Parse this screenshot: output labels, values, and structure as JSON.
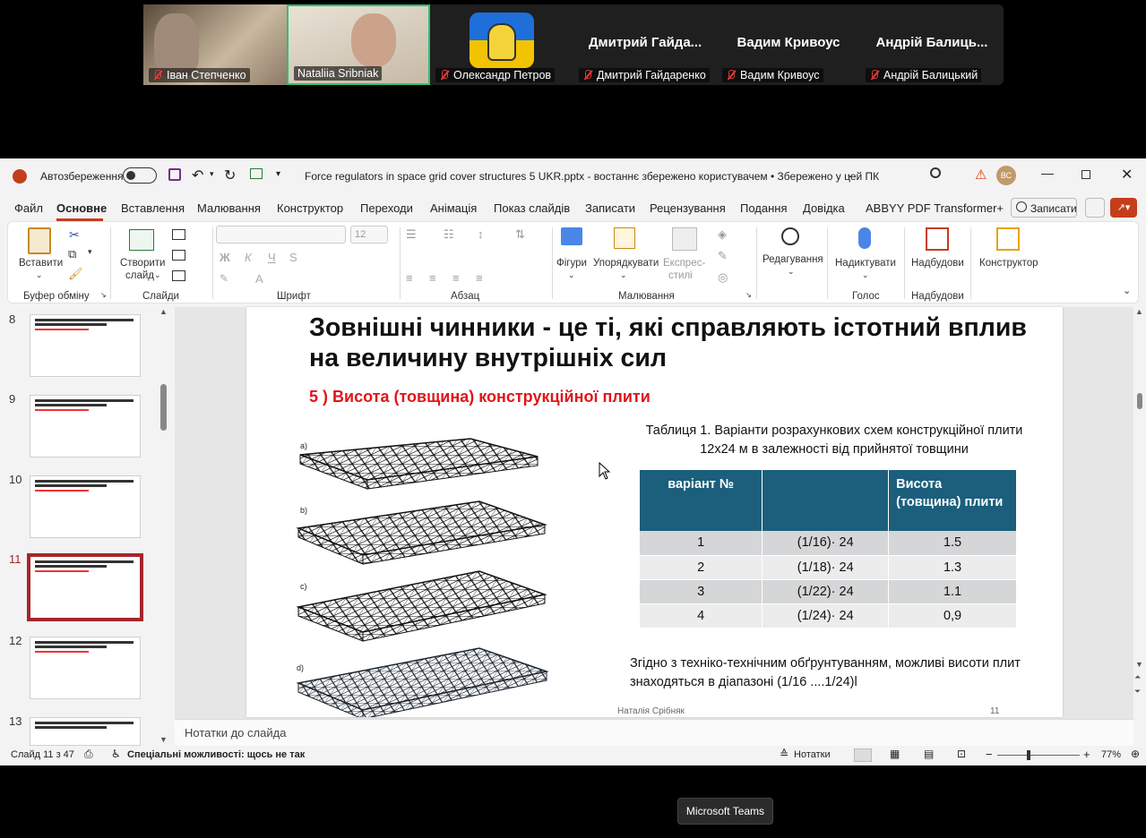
{
  "meeting": {
    "participants": [
      {
        "name": "Іван Степченко",
        "video": true
      },
      {
        "name": "Nataliia Sribniak",
        "video": true,
        "active": true
      },
      {
        "name": "Олександр Петров",
        "video": false
      },
      {
        "name": "Дмитрий Гайдаренко",
        "display": "Дмитрий  Гайда...",
        "video": false
      },
      {
        "name": "Вадим Кривоус",
        "display": "Вадим Кривоус",
        "video": false
      },
      {
        "name": "Андрій Балицький",
        "display": "Андрій  Балиць...",
        "video": false
      }
    ],
    "tooltip": "Microsoft Teams"
  },
  "titlebar": {
    "autosave_label": "Автозбереження",
    "doc_title": "Force regulators in space grid cover structures 5 UKR.pptx  -  востаннє збережено користувачем  •  Збережено у цей ПК",
    "user_initials": "ВС"
  },
  "menu": {
    "items": [
      "Файл",
      "Основне",
      "Вставлення",
      "Малювання",
      "Конструктор",
      "Переходи",
      "Анімація",
      "Показ слайдів",
      "Записати",
      "Рецензування",
      "Подання",
      "Довідка",
      "ABBYY PDF Transformer+"
    ],
    "active": "Основне",
    "record_button": "Записати"
  },
  "ribbon": {
    "paste": "Вставити",
    "new_slide_1": "Створити",
    "new_slide_2": "слайд",
    "font_size": "12",
    "shapes": "Фігури",
    "arrange": "Упорядкувати",
    "express_1": "Експрес-",
    "express_2": "стилі",
    "editing": "Редагування",
    "dictate": "Надиктувати",
    "addins": "Надбудови",
    "designer": "Конструктор",
    "groups": {
      "clipboard": "Буфер обміну",
      "slides": "Слайди",
      "font": "Шрифт",
      "paragraph": "Абзац",
      "drawing": "Малювання",
      "voice": "Голос",
      "addins": "Надбудови"
    }
  },
  "thumbnails": [
    {
      "num": "8"
    },
    {
      "num": "9"
    },
    {
      "num": "10"
    },
    {
      "num": "11",
      "active": true
    },
    {
      "num": "12"
    },
    {
      "num": "13"
    }
  ],
  "slide": {
    "title": "Зовнішні чинники - це ті, які справляють істотний вплив на величину внутрішніх сил",
    "subtitle": "5 ) Висота (товщина) конструкційної плити",
    "caption": "Таблиця 1. Варіанти розрахункових схем конструкційної плити 12х24 м в залежності від прийнятої товщини",
    "grid_labels": [
      "a)",
      "b)",
      "c)",
      "d)"
    ],
    "table": {
      "headers": [
        "варіант №",
        "",
        "Висота (товщина) плити"
      ],
      "rows": [
        [
          "1",
          "(1/16)· 24",
          "1.5"
        ],
        [
          "2",
          "(1/18)· 24",
          "1.3"
        ],
        [
          "3",
          "(1/22)· 24",
          "1.1"
        ],
        [
          "4",
          "(1/24)· 24",
          "0,9"
        ]
      ]
    },
    "bottom_text": "Згідно з техніко-технічним обґрунтуванням, можливі висоти плит знаходяться в діапазоні (1/16 ....1/24)l",
    "author": "Наталія Срібняк",
    "page": "11"
  },
  "notes_placeholder": "Нотатки до слайда",
  "status": {
    "slide_of": "Слайд 11 з 47",
    "accessibility": "Спеціальні можливості: щось не так",
    "notes_button": "Нотатки",
    "zoom": "77%"
  }
}
